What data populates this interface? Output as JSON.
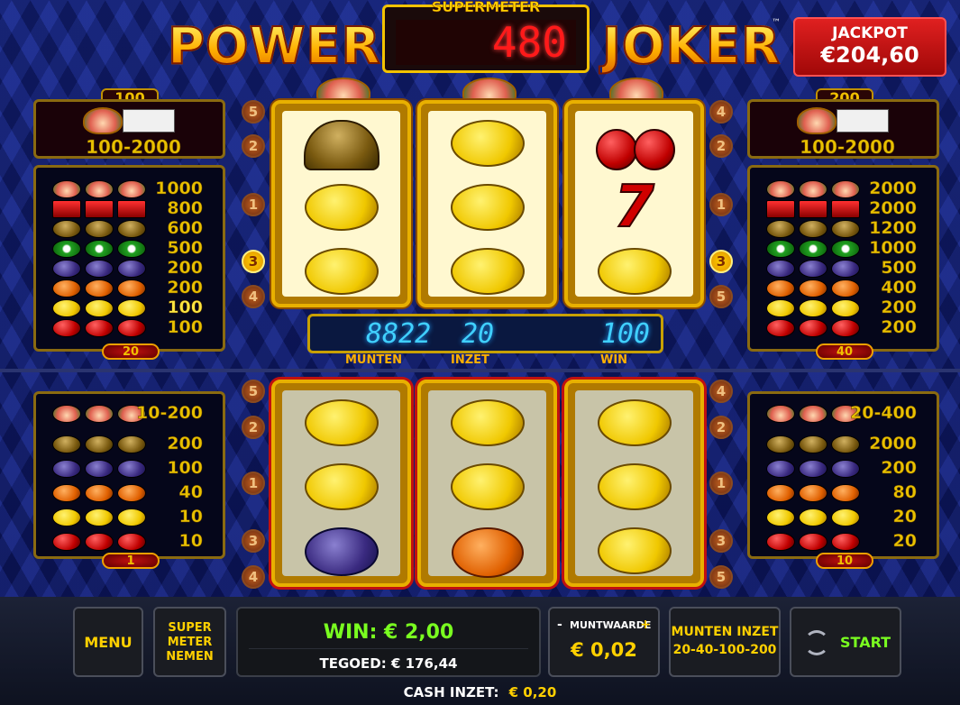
{
  "title": {
    "left": "POWER",
    "right": "JOKER",
    "tm": "™"
  },
  "supermeter": {
    "label": "SUPERMETER",
    "value": "480"
  },
  "jackpot": {
    "label": "JACKPOT",
    "amount": "€204,60"
  },
  "upper_left_table": {
    "top_value": "100",
    "range": "100-2000",
    "rows": [
      {
        "symbol": "joker",
        "value": "1000"
      },
      {
        "symbol": "seven",
        "value": "800"
      },
      {
        "symbol": "bell",
        "value": "600"
      },
      {
        "symbol": "melon",
        "value": "500"
      },
      {
        "symbol": "plum",
        "value": "200"
      },
      {
        "symbol": "orange",
        "value": "200"
      },
      {
        "symbol": "lemon",
        "value": "100"
      },
      {
        "symbol": "cherry",
        "value": "100"
      }
    ],
    "bottom_value": "20"
  },
  "upper_right_table": {
    "top_value": "200",
    "range": "100-2000",
    "rows": [
      {
        "symbol": "joker",
        "value": "2000"
      },
      {
        "symbol": "seven",
        "value": "2000"
      },
      {
        "symbol": "bell",
        "value": "1200"
      },
      {
        "symbol": "melon",
        "value": "1000"
      },
      {
        "symbol": "plum",
        "value": "500"
      },
      {
        "symbol": "orange",
        "value": "400"
      },
      {
        "symbol": "lemon",
        "value": "200"
      },
      {
        "symbol": "cherry",
        "value": "200"
      }
    ],
    "bottom_value": "40"
  },
  "lower_left_table": {
    "range": "10-200",
    "rows": [
      {
        "symbol": "bell",
        "value": "200"
      },
      {
        "symbol": "plum",
        "value": "100"
      },
      {
        "symbol": "orange",
        "value": "40"
      },
      {
        "symbol": "lemon",
        "value": "10"
      },
      {
        "symbol": "cherry",
        "value": "10"
      }
    ],
    "bottom_value": "1"
  },
  "lower_right_table": {
    "range": "20-400",
    "rows": [
      {
        "symbol": "bell",
        "value": "2000"
      },
      {
        "symbol": "plum",
        "value": "200"
      },
      {
        "symbol": "orange",
        "value": "80"
      },
      {
        "symbol": "lemon",
        "value": "20"
      },
      {
        "symbol": "cherry",
        "value": "20"
      }
    ],
    "bottom_value": "10"
  },
  "upper_markers": {
    "left": [
      "5",
      "2",
      "1",
      "3",
      "4"
    ],
    "right": [
      "4",
      "2",
      "1",
      "3",
      "5"
    ],
    "active": "3"
  },
  "lower_markers": {
    "left": [
      "5",
      "2",
      "1",
      "3",
      "4"
    ],
    "right": [
      "4",
      "2",
      "1",
      "3",
      "5"
    ]
  },
  "counter": {
    "munten": "8822",
    "inzet": "20",
    "win": "100",
    "munten_label": "MUNTEN",
    "inzet_label": "INZET",
    "win_label": "WIN"
  },
  "upper_reels": [
    [
      "bell",
      "lemon",
      "lemon"
    ],
    [
      "lemon",
      "lemon",
      "lemon"
    ],
    [
      "cherry",
      "seven",
      "lemon"
    ]
  ],
  "lower_reels": [
    [
      "lemon",
      "lemon",
      "plum"
    ],
    [
      "lemon",
      "lemon",
      "orange"
    ],
    [
      "lemon",
      "lemon",
      "lemon"
    ]
  ],
  "controls": {
    "menu": "MENU",
    "supermeter_take": [
      "SUPER",
      "METER",
      "NEMEN"
    ],
    "win": "WIN: € 2,00",
    "credit": "TEGOED: € 176,44",
    "coin_value_label": "MUNTWAARDE",
    "coin_minus": "-",
    "coin_plus": "+",
    "coin_value": "€ 0,02",
    "coins_bet_label": "MUNTEN INZET",
    "coins_bet_options": "20-40-100-200",
    "start": "START",
    "cash_bet_label": "CASH INZET:",
    "cash_bet_value": "€ 0,20"
  },
  "colors": {
    "accent_gold": "#e8b000",
    "win_green": "#7aff20",
    "jackpot_red": "#d01818",
    "lcd_blue": "#40d0ff",
    "meter_red": "#ff1a1a"
  }
}
